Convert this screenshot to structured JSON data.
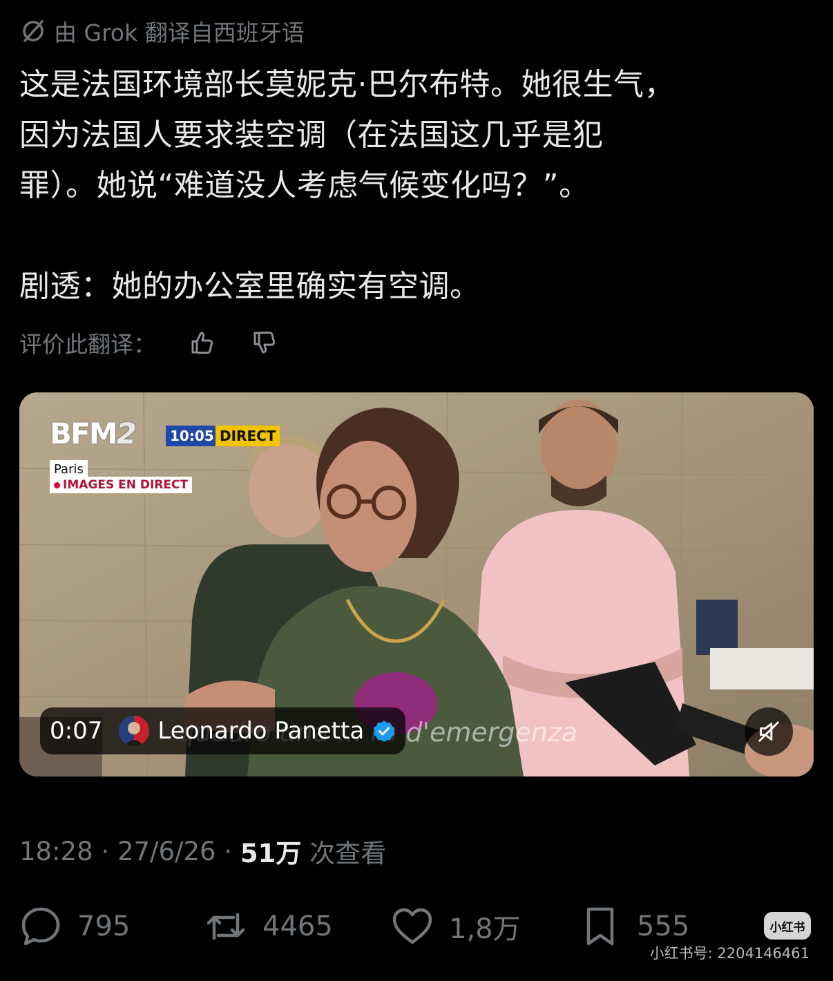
{
  "translation": {
    "label": "由 Grok 翻译自西班牙语",
    "icon": "grok-icon"
  },
  "tweet": {
    "text": "这是法国环境部长莫妮克·巴尔布特。她很生气，\n因为法国人要求装空调（在法国这几乎是犯\n罪）。她说“难道没人考虑气候变化吗？”。\n\n剧透：她的办公室里确实有空调。"
  },
  "rating": {
    "label": "评价此翻译：",
    "up_icon": "thumbs-up-icon",
    "down_icon": "thumbs-down-icon"
  },
  "video": {
    "channel_logo_main": "BFM",
    "channel_logo_suffix": "2",
    "broadcast_time": "10:05",
    "broadcast_status": "DIRECT",
    "location": "Paris",
    "live_label": "IMAGES EN DIRECT",
    "subtitle": "quadro una ... ra d'emergenza",
    "elapsed": "0:07",
    "author": "Leonardo Panetta",
    "mute_icon": "volume-muted-icon"
  },
  "meta": {
    "time": "18:28",
    "date": "27/6/26",
    "separator": " · ",
    "views_count": "51万",
    "views_label": " 次查看"
  },
  "actions": {
    "replies": "795",
    "reposts": "4465",
    "likes": "1,8万",
    "bookmarks": "555"
  },
  "watermark": {
    "logo": "小红书",
    "text": "小红书号: 2204146461"
  },
  "colors": {
    "background": "#000000",
    "text_primary": "#e7e9ea",
    "text_secondary": "#71767b",
    "verified": "#1d9bf0"
  }
}
